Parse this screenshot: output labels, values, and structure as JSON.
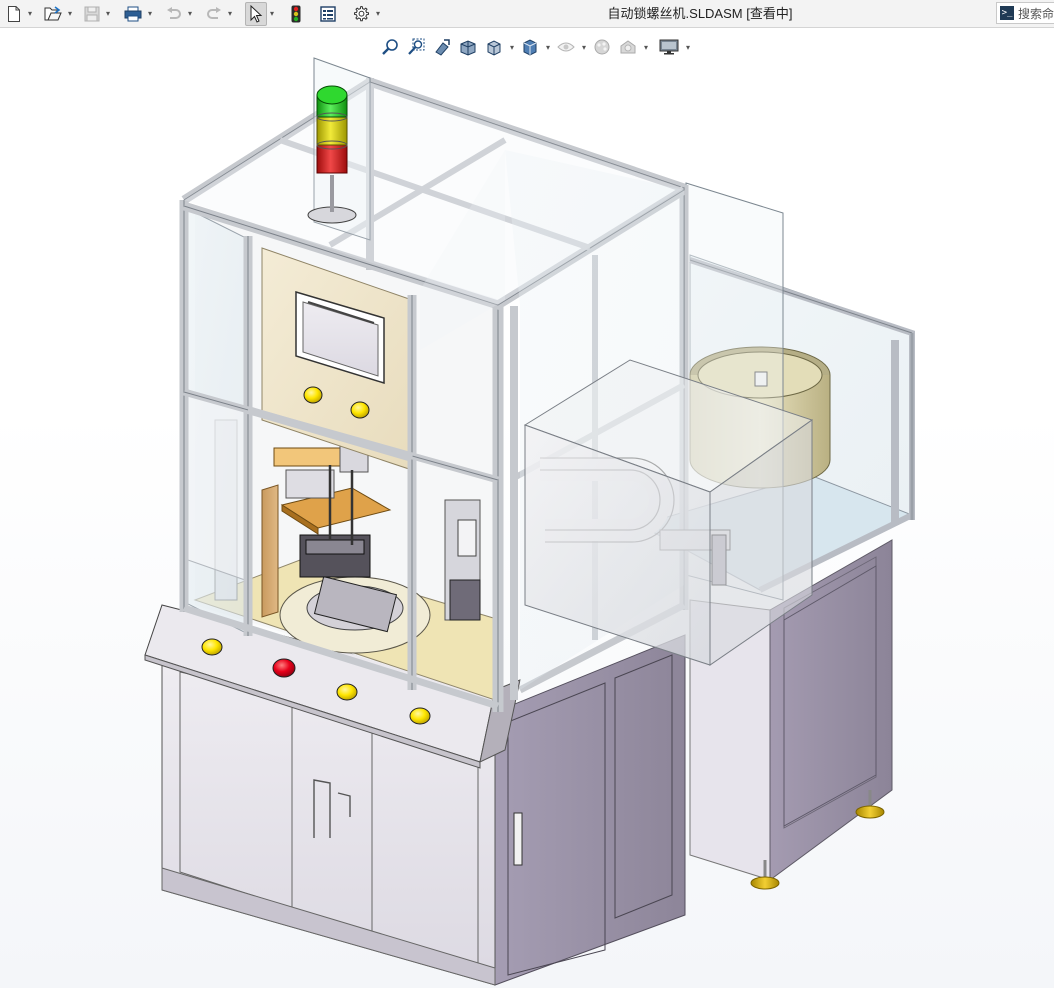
{
  "window": {
    "document_title": "自动锁螺丝机.SLDASM [查看中]"
  },
  "toolbar": {
    "buttons": [
      {
        "name": "new-document-button",
        "icon": "new-document-icon"
      },
      {
        "name": "open-button",
        "icon": "open-folder-icon"
      },
      {
        "name": "save-button",
        "icon": "save-icon"
      },
      {
        "name": "print-button",
        "icon": "printer-icon"
      },
      {
        "name": "undo-button",
        "icon": "undo-icon"
      },
      {
        "name": "redo-button",
        "icon": "redo-icon"
      },
      {
        "name": "select-button",
        "icon": "cursor-icon"
      },
      {
        "name": "rebuild-button",
        "icon": "traffic-light-icon"
      },
      {
        "name": "file-properties-button",
        "icon": "properties-icon"
      },
      {
        "name": "options-button",
        "icon": "gear-icon"
      }
    ]
  },
  "search": {
    "placeholder": "搜索命"
  },
  "view_toolbar": {
    "buttons": [
      {
        "name": "zoom-to-fit-button",
        "icon": "zoom-fit-icon"
      },
      {
        "name": "zoom-to-area-button",
        "icon": "zoom-area-icon"
      },
      {
        "name": "previous-view-button",
        "icon": "previous-view-icon"
      },
      {
        "name": "section-view-button",
        "icon": "section-view-icon"
      },
      {
        "name": "view-orientation-button",
        "icon": "view-orientation-icon"
      },
      {
        "name": "display-style-button",
        "icon": "display-style-icon"
      },
      {
        "name": "hide-show-items-button",
        "icon": "eye-icon"
      },
      {
        "name": "edit-appearance-button",
        "icon": "appearance-icon"
      },
      {
        "name": "apply-scene-button",
        "icon": "scene-icon"
      },
      {
        "name": "view-settings-button",
        "icon": "monitor-icon"
      }
    ]
  },
  "colors": {
    "frame": "#c9ccd1",
    "panel": "#efe6cf",
    "cabinet": "#9b93a8",
    "cabinet_light": "#e6e3ea",
    "glass": "#e4eef3",
    "button_yellow": "#ffe600",
    "button_red": "#e8001a",
    "tower_green": "#1fc21f",
    "tower_yellow": "#d8d000",
    "tower_red": "#d81818",
    "bowl": "#d9d2a6",
    "screen": "#f2f4f6"
  }
}
